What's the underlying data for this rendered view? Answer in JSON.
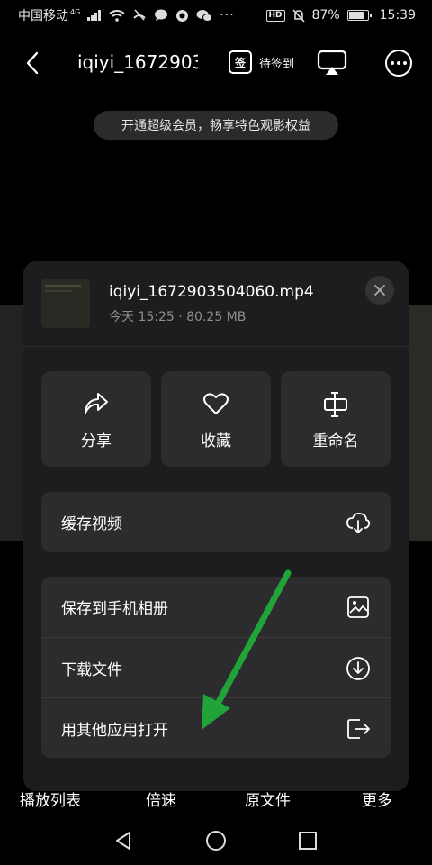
{
  "status_bar": {
    "carrier": "中国移动",
    "network": "4G",
    "hd": "HD",
    "battery_percent": "87%",
    "battery_level": 0.87,
    "time": "15:39",
    "icons": [
      "signal-icon",
      "wifi-icon",
      "no-call-icon",
      "message-icon",
      "app-icon",
      "wechat-icon",
      "mute-icon",
      "battery-icon"
    ]
  },
  "toolbar": {
    "title": "iqiyi_1672903",
    "sign_icon_text": "签",
    "sign_label": "待签到"
  },
  "vip_banner": "开通超级会员，畅享特色观影权益",
  "sheet": {
    "file_name": "iqiyi_1672903504060.mp4",
    "file_meta": "今天 15:25 · 80.25 MB",
    "actions": [
      {
        "label": "分享",
        "icon": "share-icon"
      },
      {
        "label": "收藏",
        "icon": "heart-icon"
      },
      {
        "label": "重命名",
        "icon": "rename-icon"
      }
    ],
    "cache_label": "缓存视频",
    "menu": [
      {
        "label": "保存到手机相册",
        "icon": "save-to-album-icon"
      },
      {
        "label": "下载文件",
        "icon": "download-icon"
      },
      {
        "label": "用其他应用打开",
        "icon": "open-with-icon"
      }
    ]
  },
  "player_bar": [
    "播放列表",
    "倍速",
    "原文件",
    "更多"
  ],
  "colors": {
    "background": "#000000",
    "sheet": "#1d1d1f",
    "card": "#2c2c2e",
    "annotation_arrow": "#21a33a"
  }
}
